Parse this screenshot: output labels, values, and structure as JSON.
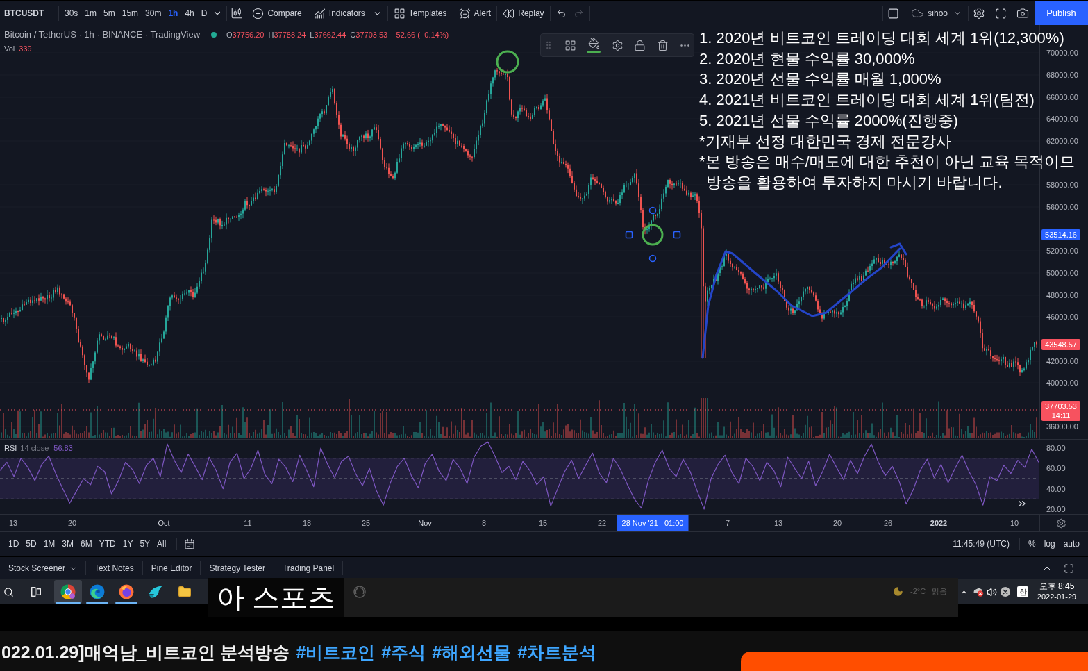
{
  "toolbar": {
    "symbol": "BTCUSDT",
    "intervals": [
      {
        "label": "30s",
        "selected": false
      },
      {
        "label": "1m",
        "selected": false
      },
      {
        "label": "5m",
        "selected": false
      },
      {
        "label": "15m",
        "selected": false
      },
      {
        "label": "30m",
        "selected": false
      },
      {
        "label": "1h",
        "selected": true
      },
      {
        "label": "4h",
        "selected": false
      },
      {
        "label": "D",
        "selected": false
      }
    ],
    "tools": [
      {
        "kind": "compare",
        "label": "Compare",
        "dropdown": false
      },
      {
        "kind": "indicators",
        "label": "Indicators",
        "dropdown": true
      },
      {
        "kind": "templates",
        "label": "Templates",
        "dropdown": false
      },
      {
        "kind": "alert",
        "label": "Alert",
        "dropdown": false
      },
      {
        "kind": "replay",
        "label": "Replay",
        "dropdown": false
      }
    ],
    "layout_name": "sihoo",
    "publish": "Publish"
  },
  "legend": {
    "title": "Bitcoin / TetherUS · 1h · BINANCE · TradingView",
    "ohlc": [
      {
        "label": "O",
        "value": "37756.20"
      },
      {
        "label": "H",
        "value": "37788.24"
      },
      {
        "label": "L",
        "value": "37662.44"
      },
      {
        "label": "C",
        "value": "37703.53"
      }
    ],
    "change": "−52.66 (−0.14%)",
    "volume": {
      "label": "Vol",
      "value": "339"
    }
  },
  "overlay_lines": [
    {
      "kind": "item",
      "text": "1. 2020년 비트코인 트레이딩 대회 세계 1위(12,300%)"
    },
    {
      "kind": "item",
      "text": "2. 2020년 현물 수익률 30,000%"
    },
    {
      "kind": "item",
      "text": "3. 2020년 선물 수익률 매월 1,000%"
    },
    {
      "kind": "item",
      "text": "4. 2021년 비트코인 트레이딩 대회 세계 1위(팀전)"
    },
    {
      "kind": "item",
      "text": "5. 2021년 선물 수익률 2000%(진행중)"
    },
    {
      "kind": "item",
      "text": "*기재부 선정 대한민국 경제 전문강사"
    },
    {
      "kind": "item",
      "text": "*본 방송은 매수/매도에 대한 추천이 아닌 교육 목적이므"
    },
    {
      "kind": "continuation",
      "text": "방송을 활용하여 투자하지 마시기 바랍니다."
    }
  ],
  "price_axis": {
    "labels": [
      "70000.00",
      "68000.00",
      "66000.00",
      "64000.00",
      "62000.00",
      "58000.00",
      "56000.00",
      "52000.00",
      "50000.00",
      "48000.00",
      "46000.00",
      "42000.00",
      "40000.00",
      "36000.00"
    ],
    "badges": [
      {
        "value": "53514.16",
        "color": "#2962ff"
      },
      {
        "value": "43548.57",
        "color": "#f7525f"
      },
      {
        "value": "37703.53",
        "countdown": "14:11",
        "color": "#f7525f"
      }
    ]
  },
  "rsi": {
    "params": "14 close",
    "value": "56.83",
    "chart_data": {
      "type": "line",
      "ylim": [
        15.2,
        88.2
      ],
      "yticks": [
        {
          "value": 80,
          "label": "80.00"
        },
        {
          "value": 60,
          "label": "60.00"
        },
        {
          "value": 40,
          "label": "40.00"
        },
        {
          "value": 20,
          "label": "20.00"
        }
      ],
      "ref_lines": [
        {
          "axis": "y",
          "value": 70
        },
        {
          "axis": "y",
          "value": 50
        },
        {
          "axis": "y",
          "value": 30
        }
      ],
      "series": [
        {
          "name": "RSI",
          "color": "#7e57c2",
          "values": [
            58,
            66,
            52,
            70,
            61,
            48,
            64,
            72,
            55,
            40,
            26,
            38,
            50,
            44,
            62,
            57,
            35,
            48,
            66,
            59,
            45,
            63,
            70,
            52,
            84,
            68,
            56,
            74,
            62,
            49,
            71,
            58,
            40,
            66,
            75,
            50,
            60,
            78,
            54,
            45,
            69,
            61,
            47,
            73,
            58,
            42,
            80,
            64,
            51,
            67,
            72,
            55,
            43,
            60,
            38,
            24,
            46,
            62,
            70,
            53,
            41,
            65,
            74,
            57,
            48,
            69,
            60,
            45,
            71,
            82,
            86,
            72,
            56,
            62,
            49,
            67,
            58,
            44,
            52,
            23,
            40,
            57,
            68,
            50,
            63,
            75,
            55,
            46,
            70,
            59,
            44,
            30,
            21,
            48,
            66,
            78,
            60,
            52,
            69,
            57,
            38,
            20,
            50,
            64,
            73,
            56,
            45,
            70,
            62,
            48,
            66,
            58,
            42,
            71,
            60,
            50,
            67,
            43,
            57,
            74,
            61,
            49,
            68,
            55,
            72,
            84,
            66,
            53,
            62,
            47,
            25,
            39,
            58,
            69,
            51,
            64,
            46,
            60,
            73,
            57,
            44,
            24,
            52,
            48,
            63,
            55,
            68,
            61,
            79,
            66
          ]
        }
      ]
    }
  },
  "time_axis": [
    {
      "kind": "day",
      "label": "13"
    },
    {
      "kind": "day",
      "label": "20"
    },
    {
      "kind": "month",
      "label": "Oct"
    },
    {
      "kind": "day",
      "label": "11"
    },
    {
      "kind": "day",
      "label": "18"
    },
    {
      "kind": "day",
      "label": "25"
    },
    {
      "kind": "month",
      "label": "Nov"
    },
    {
      "kind": "day",
      "label": "8"
    },
    {
      "kind": "day",
      "label": "15"
    },
    {
      "kind": "day",
      "label": "22"
    },
    {
      "kind": "crosshair",
      "label": "28 Nov '21   01:00"
    },
    {
      "kind": "day",
      "label": "7"
    },
    {
      "kind": "day",
      "label": "13"
    },
    {
      "kind": "day",
      "label": "20"
    },
    {
      "kind": "day",
      "label": "26"
    },
    {
      "kind": "year",
      "label": "2022"
    },
    {
      "kind": "day",
      "label": "10"
    }
  ],
  "range_bar": {
    "ranges": [
      "1D",
      "5D",
      "1M",
      "3M",
      "6M",
      "YTD",
      "1Y",
      "5Y",
      "All"
    ],
    "clock": "11:45:49 (UTC)",
    "scales": [
      "%",
      "log",
      "auto"
    ]
  },
  "bottom_tabs": [
    {
      "label": "Stock Screener",
      "dropdown": true
    },
    {
      "label": "Text Notes",
      "dropdown": false
    },
    {
      "label": "Pine Editor",
      "dropdown": false
    },
    {
      "label": "Strategy Tester",
      "dropdown": false
    },
    {
      "label": "Trading Panel",
      "dropdown": false
    }
  ],
  "taskbar": {
    "apps": [
      {
        "kind": "chrome",
        "selected": true,
        "running": true
      },
      {
        "kind": "edge",
        "selected": false,
        "running": true
      },
      {
        "kind": "firefox",
        "selected": false,
        "running": true
      },
      {
        "kind": "feather",
        "selected": false,
        "running": false
      },
      {
        "kind": "folder",
        "selected": false,
        "running": false
      }
    ],
    "weather": {
      "temperature": "-2°C",
      "condition": "맑음"
    },
    "ime": "한",
    "time": "오후 8:45",
    "date": "2022-01-29"
  },
  "caption": {
    "text": "아 스포츠"
  },
  "video": {
    "title": "022.01.29]매억남_비트코인 분석방송",
    "hashtags": [
      "#비트코인",
      "#주식",
      "#해외선물",
      "#차트분석"
    ]
  }
}
